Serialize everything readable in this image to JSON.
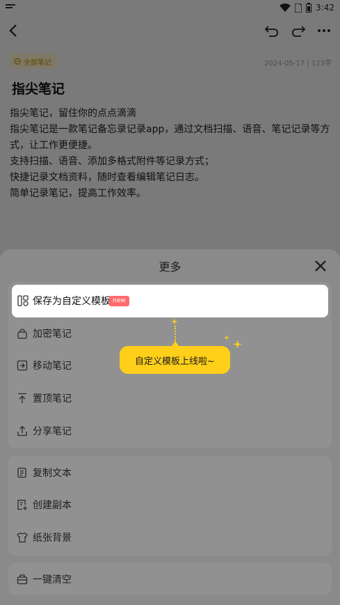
{
  "status_bar": {
    "time": "3:42"
  },
  "note": {
    "tag": "全部笔记",
    "meta": "2024-05-17 | 123字",
    "title": "指尖笔记",
    "body": [
      "指尖笔记，留住你的点点滴滴",
      "指尖笔记是一款笔记备忘录记录app，通过文档扫描、语音、笔记记录等方式，让工作更便捷。",
      "支持扫描、语音、添加多格式附件等记录方式；",
      "快捷记录文档资料，随时查看编辑笔记日志。",
      "简单记录笔记，提高工作效率。"
    ]
  },
  "sheet": {
    "title": "更多",
    "highlight_item": {
      "label": "保存为自定义模板",
      "badge": "new",
      "icon": "template-icon"
    },
    "tooltip": "自定义模板上线啦~",
    "group1": [
      {
        "label": "加密笔记",
        "icon": "lock-icon"
      },
      {
        "label": "移动笔记",
        "icon": "move-icon"
      },
      {
        "label": "置顶笔记",
        "icon": "pin-top-icon"
      },
      {
        "label": "分享笔记",
        "icon": "share-icon"
      }
    ],
    "group2": [
      {
        "label": "复制文本",
        "icon": "copy-text-icon"
      },
      {
        "label": "创建副本",
        "icon": "duplicate-icon"
      },
      {
        "label": "纸张背景",
        "icon": "paper-bg-icon"
      }
    ],
    "group3": [
      {
        "label": "一键清空",
        "icon": "clear-icon"
      }
    ]
  },
  "colors": {
    "accent": "#ffcf1a",
    "badge": "#ff6b6b",
    "tag_text": "#c58b00"
  }
}
